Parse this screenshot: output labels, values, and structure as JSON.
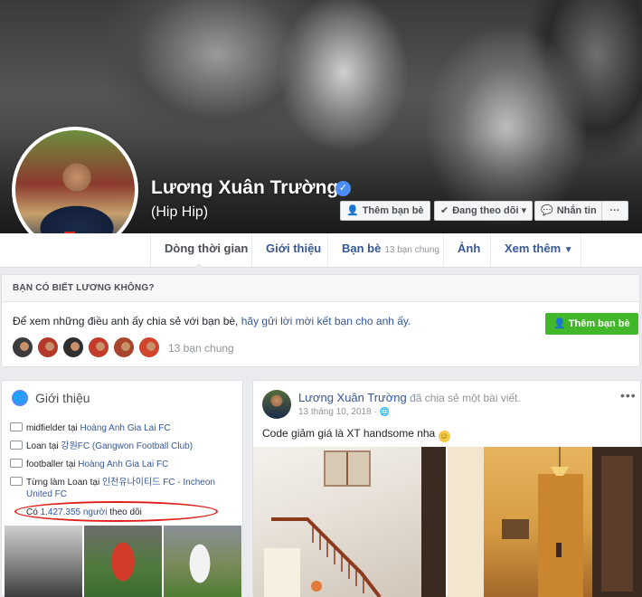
{
  "profile": {
    "name": "Lương Xuân Trường",
    "nickname": "(Hip Hip)",
    "verified_icon": "verified-badge-icon"
  },
  "cover_actions": {
    "add_friend": "Thêm bạn bè",
    "following": "Đang theo dõi",
    "message": "Nhắn tin",
    "more": "···"
  },
  "nav": {
    "timeline": "Dòng thời gian",
    "about": "Giới thiệu",
    "friends": "Bạn bè",
    "friends_sub": "13 bạn chung",
    "photos": "Ảnh",
    "more": "Xem thêm"
  },
  "know": {
    "header": "BẠN CÓ BIẾT LƯƠNG KHÔNG?",
    "text_prefix": "Để xem những điều anh ấy chia sẻ với bạn bè,",
    "text_link": "hãy gửi lời mời kết bạn cho anh ấy.",
    "add_friend": "Thêm bạn bè",
    "mutual": "13 bạn chung"
  },
  "intro": {
    "title": "Giới thiệu",
    "rows": [
      {
        "prefix": "midfielder tại",
        "link": "Hoàng Anh Gia Lai FC",
        "suffix": ""
      },
      {
        "prefix": "Loan tại",
        "link": "강원FC (Gangwon Football Club)",
        "suffix": ""
      },
      {
        "prefix": "footballer tại",
        "link": "Hoàng Anh Gia Lai FC",
        "suffix": ""
      },
      {
        "prefix": "Từng làm Loan tại",
        "link": "인천유나이티드 FC - Incheon United FC",
        "suffix": ""
      },
      {
        "prefix": "Có",
        "link": "1.427.355 người",
        "suffix": "theo dõi"
      }
    ]
  },
  "post": {
    "author": "Lương Xuân Trường",
    "action": "đã chia sẻ một bài viết.",
    "date": "13 tháng 10, 2018 ·",
    "text": "Code giảm giá là XT handsome nha",
    "more": "•••"
  },
  "colors": {
    "link": "#365899",
    "green_button": "#42b72a",
    "highlight_oval": "#e0201b"
  }
}
